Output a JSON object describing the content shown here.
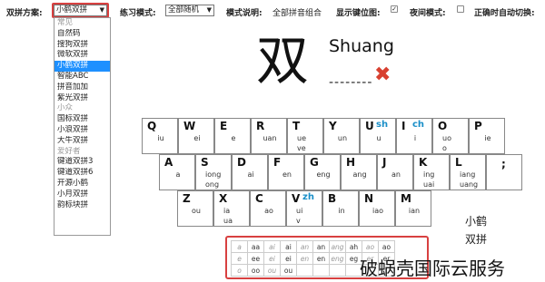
{
  "toolbar": {
    "scheme_label": "双拼方案:",
    "scheme_value": "小鹤双拼",
    "practice_label": "练习模式:",
    "practice_value": "全部随机",
    "mode_desc_label": "模式说明:",
    "mode_desc_value": "全部拼音组合",
    "show_keys_label": "显示键位图:",
    "show_keys_checked": true,
    "night_label": "夜间模式:",
    "night_checked": false,
    "auto_switch_label": "正确时自动切换:"
  },
  "scheme_dropdown": [
    {
      "label": "常见",
      "group": true
    },
    {
      "label": "自然码"
    },
    {
      "label": "搜狗双拼"
    },
    {
      "label": "微软双拼"
    },
    {
      "label": "小鹤双拼",
      "selected": true
    },
    {
      "label": "智能ABC"
    },
    {
      "label": "拼音加加"
    },
    {
      "label": "紫光双拼"
    },
    {
      "label": "小众",
      "group": true
    },
    {
      "label": "国标双拼"
    },
    {
      "label": "小浪双拼"
    },
    {
      "label": "大牛双拼"
    },
    {
      "label": "爱好者",
      "group": true
    },
    {
      "label": "键道双拼3"
    },
    {
      "label": "键道双拼6"
    },
    {
      "label": "开源小鹤"
    },
    {
      "label": "小月双拼"
    },
    {
      "label": "韵标块拼"
    }
  ],
  "practice": {
    "character": "双",
    "pinyin": "Shuang",
    "typed": "--------",
    "result_icon": "wrong-icon"
  },
  "keyboard": {
    "row1": [
      {
        "key": "Q",
        "finals": [
          "iu"
        ]
      },
      {
        "key": "W",
        "finals": [
          "ei"
        ]
      },
      {
        "key": "E",
        "finals": [
          "e"
        ]
      },
      {
        "key": "R",
        "finals": [
          "uan"
        ]
      },
      {
        "key": "T",
        "finals": [
          "ue",
          "ve"
        ]
      },
      {
        "key": "Y",
        "finals": [
          "un"
        ]
      },
      {
        "key": "U",
        "initial": "sh",
        "finals": [
          "u"
        ]
      },
      {
        "key": "I",
        "initial": "ch",
        "finals": [
          "i"
        ]
      },
      {
        "key": "O",
        "finals": [
          "uo",
          "o"
        ]
      },
      {
        "key": "P",
        "finals": [
          "ie"
        ]
      }
    ],
    "row2": [
      {
        "key": "A",
        "finals": [
          "a"
        ]
      },
      {
        "key": "S",
        "finals": [
          "iong",
          "ong"
        ]
      },
      {
        "key": "D",
        "finals": [
          "ai"
        ]
      },
      {
        "key": "F",
        "finals": [
          "en"
        ]
      },
      {
        "key": "G",
        "finals": [
          "eng"
        ]
      },
      {
        "key": "H",
        "finals": [
          "ang"
        ]
      },
      {
        "key": "J",
        "finals": [
          "an"
        ]
      },
      {
        "key": "K",
        "finals": [
          "ing",
          "uai"
        ]
      },
      {
        "key": "L",
        "finals": [
          "iang",
          "uang"
        ]
      },
      {
        "key": ";",
        "finals": []
      }
    ],
    "row3": [
      {
        "key": "Z",
        "finals": [
          "ou"
        ]
      },
      {
        "key": "X",
        "finals": [
          "ia",
          "ua"
        ]
      },
      {
        "key": "C",
        "finals": [
          "ao"
        ]
      },
      {
        "key": "V",
        "initial": "zh",
        "finals": [
          "ui",
          "v"
        ]
      },
      {
        "key": "B",
        "finals": [
          "in"
        ]
      },
      {
        "key": "N",
        "finals": [
          "iao"
        ]
      },
      {
        "key": "M",
        "finals": [
          "ian"
        ]
      }
    ]
  },
  "scheme_name_lines": [
    "小鹤",
    "双拼"
  ],
  "zero_initial_table": [
    [
      "a",
      "aa",
      "ai",
      "ai",
      "an",
      "an",
      "ang",
      "ah",
      "ao",
      "ao"
    ],
    [
      "e",
      "ee",
      "ei",
      "ei",
      "en",
      "en",
      "eng",
      "eg",
      "er",
      "er"
    ],
    [
      "o",
      "oo",
      "ou",
      "ou",
      "",
      "",
      "",
      "",
      "",
      ""
    ]
  ],
  "watermark": "破蜗壳国际云服务"
}
